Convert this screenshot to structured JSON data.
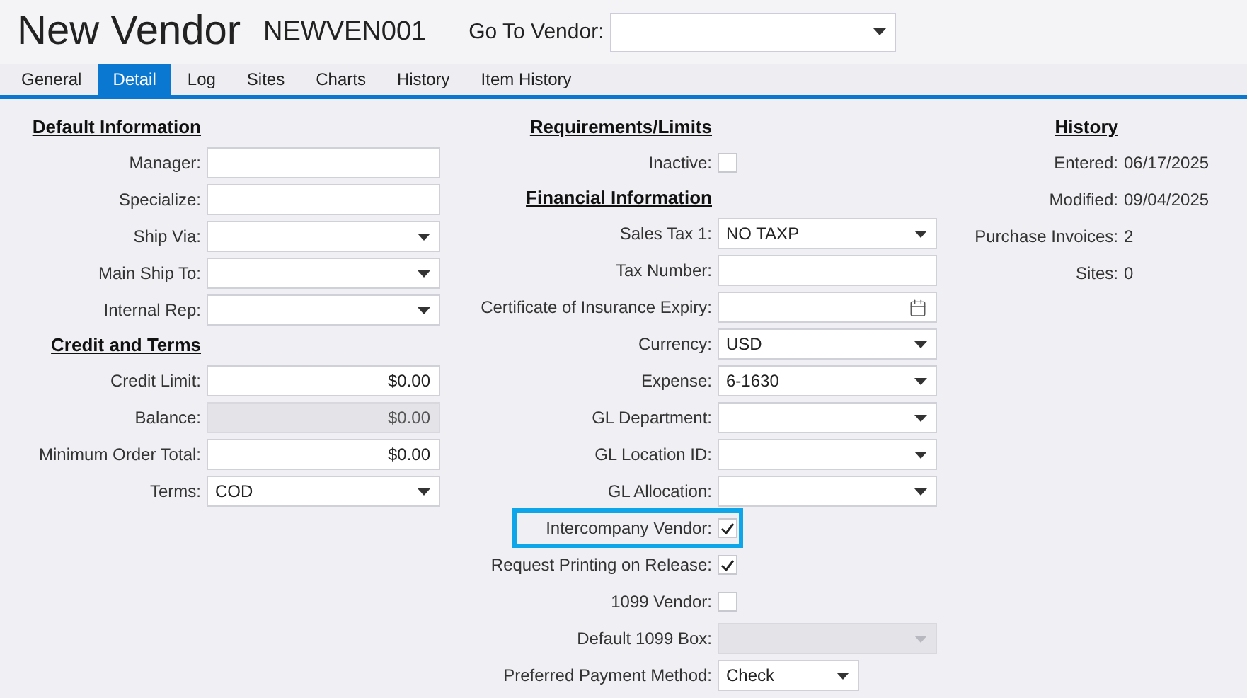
{
  "title": "New Vendor",
  "vendor_code": "NEWVEN001",
  "go_to": {
    "label": "Go To Vendor:"
  },
  "tabs": [
    {
      "label": "General",
      "selected": false
    },
    {
      "label": "Detail",
      "selected": true
    },
    {
      "label": "Log",
      "selected": false
    },
    {
      "label": "Sites",
      "selected": false
    },
    {
      "label": "Charts",
      "selected": false
    },
    {
      "label": "History",
      "selected": false
    },
    {
      "label": "Item History",
      "selected": false
    }
  ],
  "columns": [
    {
      "rows": [
        {
          "kind": "heading",
          "text": "Default Information"
        },
        {
          "kind": "text",
          "label": "Manager:",
          "disabled": false
        },
        {
          "kind": "text",
          "label": "Specialize:",
          "disabled": false
        },
        {
          "kind": "select",
          "label": "Ship Via:",
          "disabled": false
        },
        {
          "kind": "select",
          "label": "Main Ship To:",
          "disabled": false
        },
        {
          "kind": "select",
          "label": "Internal Rep:",
          "disabled": false
        },
        {
          "kind": "heading",
          "text": "Credit and Terms"
        },
        {
          "kind": "money",
          "label": "Credit Limit:",
          "value": "$0.00",
          "disabled": false
        },
        {
          "kind": "money",
          "label": "Balance:",
          "value": "$0.00",
          "disabled": true
        },
        {
          "kind": "money",
          "label": "Minimum Order Total:",
          "value": "$0.00",
          "disabled": false
        },
        {
          "kind": "select",
          "label": "Terms:",
          "value": "COD",
          "disabled": false
        }
      ]
    },
    {
      "rows": [
        {
          "kind": "heading",
          "text": "Requirements/Limits"
        },
        {
          "kind": "checkbox",
          "label": "Inactive:",
          "checked": false,
          "highlighted": false
        },
        {
          "kind": "heading",
          "text": "Financial Information"
        },
        {
          "kind": "select",
          "label": "Sales Tax 1:",
          "value": "NO TAXP",
          "disabled": false
        },
        {
          "kind": "text",
          "label": "Tax Number:",
          "disabled": false
        },
        {
          "kind": "date",
          "label": "Certificate of Insurance Expiry:",
          "disabled": false
        },
        {
          "kind": "select",
          "label": "Currency:",
          "value": "USD",
          "disabled": false
        },
        {
          "kind": "select",
          "label": "Expense:",
          "value": "6-1630",
          "disabled": false
        },
        {
          "kind": "select",
          "label": "GL Department:",
          "disabled": false
        },
        {
          "kind": "select",
          "label": "GL Location ID:",
          "disabled": false
        },
        {
          "kind": "select",
          "label": "GL Allocation:",
          "disabled": false
        },
        {
          "kind": "checkbox",
          "label": "Intercompany Vendor:",
          "checked": true,
          "highlighted": true
        },
        {
          "kind": "checkbox",
          "label": "Request Printing on Release:",
          "checked": true,
          "highlighted": false
        },
        {
          "kind": "checkbox",
          "label": "1099 Vendor:",
          "checked": false,
          "highlighted": false
        },
        {
          "kind": "select",
          "label": "Default 1099 Box:",
          "disabled": true
        },
        {
          "kind": "short-select",
          "label": "Preferred Payment Method:",
          "value": "Check",
          "disabled": false
        }
      ]
    },
    {
      "rows": [
        {
          "kind": "heading",
          "text": "History"
        },
        {
          "kind": "info",
          "label": "Entered:",
          "value": "06/17/2025"
        },
        {
          "kind": "info",
          "label": "Modified:",
          "value": "09/04/2025"
        },
        {
          "kind": "info",
          "label": "Purchase Invoices:",
          "value": "2"
        },
        {
          "kind": "info",
          "label": "Sites:",
          "value": "0"
        }
      ]
    }
  ]
}
